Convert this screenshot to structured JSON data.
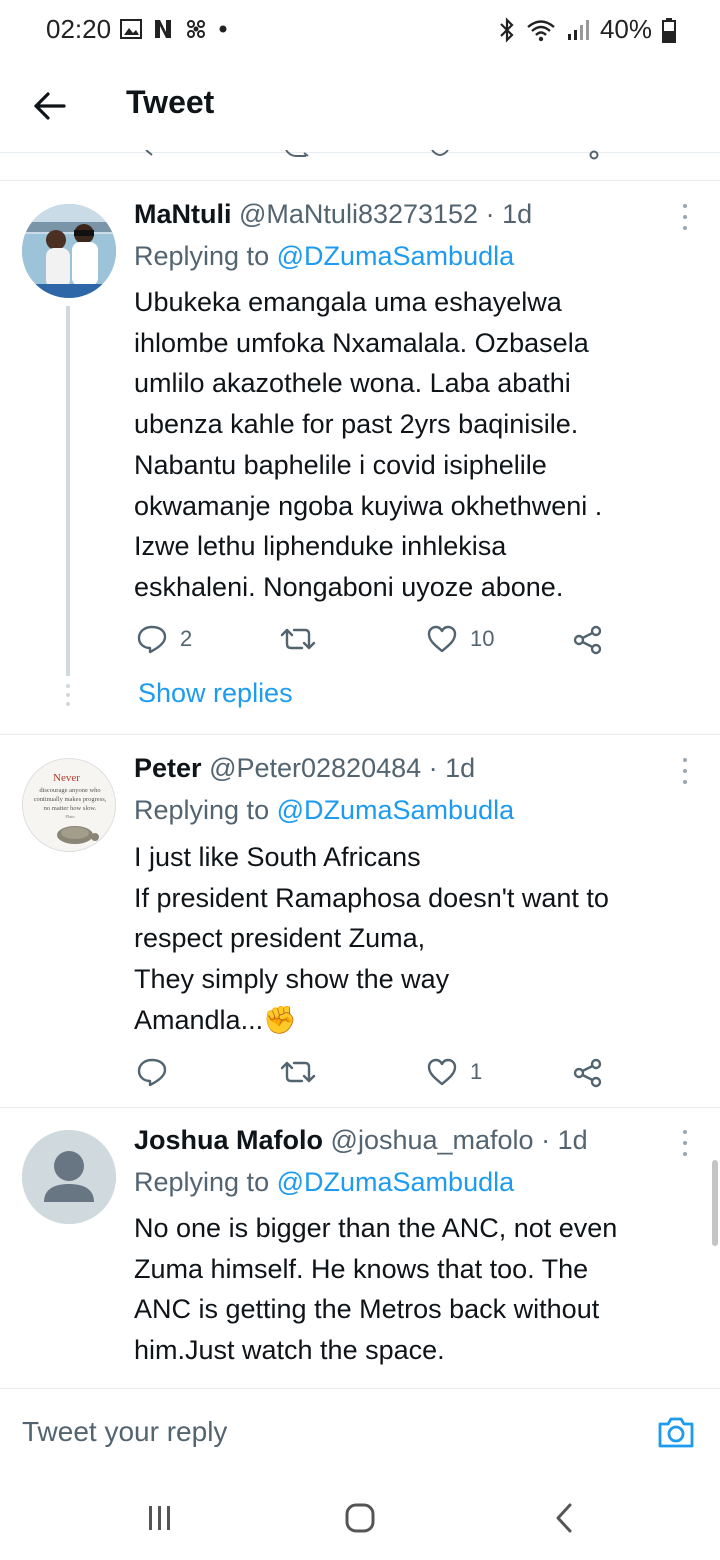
{
  "status_bar": {
    "time": "02:20",
    "battery": "40%"
  },
  "header": {
    "title": "Tweet"
  },
  "tweets": [
    {
      "name": "MaNtuli",
      "handle": "@MaNtuli83273152",
      "time": "· 1d",
      "replying_prefix": "Replying to",
      "replying_to": "@DZumaSambudla",
      "text": "Ubukeka emangala uma eshayelwa\nihlombe umfoka Nxamalala. Ozbasela\numlilo akazothele wona. Laba abathi\nubenza kahle for past 2yrs baqinisile.\nNabantu baphelile i covid isiphelile\nokwamanje ngoba kuyiwa okhethweni .\nIzwe lethu liphenduke inhlekisa\neskhaleni. Nongaboni uyoze abone.",
      "replies": "2",
      "retweets": "",
      "likes": "10",
      "show_replies": "Show replies"
    },
    {
      "name": "Peter",
      "handle": "@Peter02820484",
      "time": "· 1d",
      "replying_prefix": "Replying to",
      "replying_to": "@DZumaSambudla",
      "text": "I just like South Africans\nIf president Ramaphosa doesn't want to\nrespect president Zuma,\nThey simply show the way\nAmandla...",
      "emoji": "✊",
      "avatar_text": {
        "line1": "Never",
        "line2": "discourage anyone who",
        "line3": "continually makes progress,",
        "line4": "no matter how slow.",
        "line5": "Plato"
      },
      "replies": "",
      "retweets": "",
      "likes": "1"
    },
    {
      "name": "Joshua Mafolo",
      "handle": "@joshua_mafolo",
      "time": "· 1d",
      "replying_prefix": "Replying to",
      "replying_to": "@DZumaSambudla",
      "text": "No one is bigger than the ANC, not even\nZuma himself. He knows that too. The\nANC is getting the Metros back without\nhim.Just watch the space."
    }
  ],
  "reply_box": {
    "placeholder": "Tweet your reply"
  },
  "colors": {
    "accent": "#1d9bf0",
    "secondary_text": "#536471",
    "divider": "#e6ecf0"
  },
  "icons": [
    "back-arrow-icon",
    "reply-icon",
    "retweet-icon",
    "like-icon",
    "share-icon",
    "camera-icon",
    "more-options-icon"
  ]
}
